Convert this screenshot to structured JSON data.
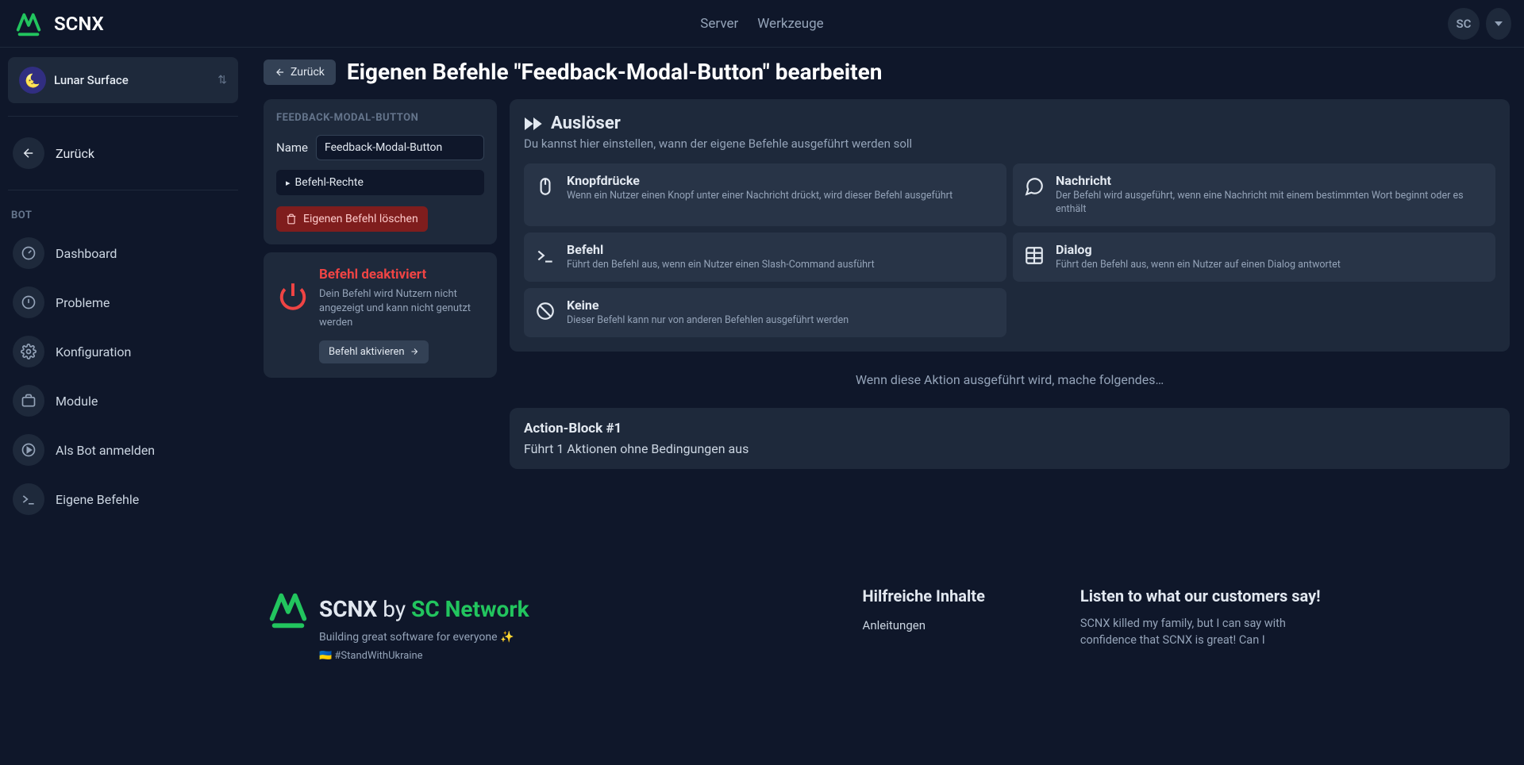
{
  "topbar": {
    "brand": "SCNX",
    "nav": {
      "server": "Server",
      "tools": "Werkzeuge"
    },
    "avatar_initials": "SC"
  },
  "sidebar": {
    "server_emoji": "🌜",
    "server_name": "Lunar Surface",
    "back": "Zurück",
    "section": "BOT",
    "items": [
      {
        "label": "Dashboard"
      },
      {
        "label": "Probleme"
      },
      {
        "label": "Konfiguration"
      },
      {
        "label": "Module"
      },
      {
        "label": "Als Bot anmelden"
      },
      {
        "label": "Eigene Befehle"
      }
    ]
  },
  "page": {
    "back_btn": "Zurück",
    "title": "Eigenen Befehle \"Feedback-Modal-Button\" bearbeiten"
  },
  "config": {
    "header": "FEEDBACK-MODAL-BUTTON",
    "name_label": "Name",
    "name_value": "Feedback-Modal-Button",
    "rights": "Befehl-Rechte",
    "delete": "Eigenen Befehl löschen"
  },
  "deactivated": {
    "title": "Befehl deaktiviert",
    "desc": "Dein Befehl wird Nutzern nicht angezeigt und kann nicht genutzt werden",
    "activate": "Befehl aktivieren"
  },
  "triggers": {
    "title": "Auslöser",
    "subtitle": "Du kannst hier einstellen, wann der eigene Befehle ausgeführt werden soll",
    "options": [
      {
        "title": "Knopfdrücke",
        "desc": "Wenn ein Nutzer einen Knopf unter einer Nachricht drückt, wird dieser Befehl ausgeführt"
      },
      {
        "title": "Nachricht",
        "desc": "Der Befehl wird ausgeführt, wenn eine Nachricht mit einem bestimmten Wort beginnt oder es enthält"
      },
      {
        "title": "Befehl",
        "desc": "Führt den Befehl aus, wenn ein Nutzer einen Slash-Command ausführt"
      },
      {
        "title": "Dialog",
        "desc": "Führt den Befehl aus, wenn ein Nutzer auf einen Dialog antwortet"
      },
      {
        "title": "Keine",
        "desc": "Dieser Befehl kann nur von anderen Befehlen ausgeführt werden"
      }
    ]
  },
  "hint": "Wenn diese Aktion ausgeführt wird, mache folgendes…",
  "action_block": {
    "title": "Action-Block #1",
    "desc": "Führt 1 Aktionen ohne Bedingungen aus"
  },
  "footer": {
    "brand": "SCNX",
    "by": "by",
    "network": "SC Network",
    "tagline": "Building great software for everyone ✨",
    "stand": "🇺🇦 #StandWithUkraine",
    "help_title": "Hilfreiche Inhalte",
    "help_links": {
      "guides": "Anleitungen"
    },
    "testimonial_title": "Listen to what our customers say!",
    "testimonial_body": "SCNX killed my family, but I can say with confidence that SCNX is great! Can I"
  }
}
